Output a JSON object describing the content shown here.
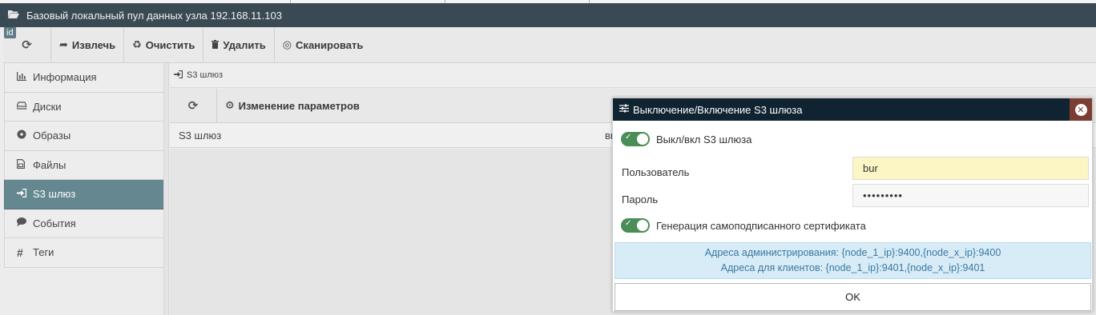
{
  "window": {
    "title": "Базовый локальный пул данных узла 192.168.11.103",
    "id_tag": "id"
  },
  "toolbar": {
    "extract_label": "Извлечь",
    "clear_label": "Очистить",
    "delete_label": "Удалить",
    "scan_label": "Сканировать"
  },
  "sidebar": {
    "items": [
      {
        "label": "Информация",
        "icon": "bar-chart-icon"
      },
      {
        "label": "Диски",
        "icon": "hdd-icon"
      },
      {
        "label": "Образы",
        "icon": "disc-icon"
      },
      {
        "label": "Файлы",
        "icon": "file-icon"
      },
      {
        "label": "S3 шлюз",
        "icon": "sign-in-icon",
        "active": true
      },
      {
        "label": "События",
        "icon": "comment-icon"
      },
      {
        "label": "Теги",
        "icon": "hashtag-icon"
      }
    ]
  },
  "breadcrumb": {
    "label": "S3 шлюз"
  },
  "subtoolbar": {
    "change_params_label": "Изменение параметров"
  },
  "table": {
    "columns": [
      "S3 шлюз",
      "вы"
    ]
  },
  "dialog": {
    "title": "Выключение/Включение S3 шлюза",
    "toggle_gateway_label": "Выкл/вкл S3 шлюза",
    "toggle_gateway_on": true,
    "user_label": "Пользователь",
    "user_value": "bur",
    "password_label": "Пароль",
    "password_value": "•••••••••",
    "toggle_cert_label": "Генерация самоподписанного сертификата",
    "toggle_cert_on": true,
    "admin_addresses": "Адреса администрирования: {node_1_ip}:9400,{node_x_ip}:9400",
    "client_addresses": "Адреса для клиентов: {node_1_ip}:9401,{node_x_ip}:9401",
    "ok_label": "OK"
  },
  "colors": {
    "titlebar": "#394a54",
    "sidebar_active": "#648790",
    "dialog_header": "#0f2330",
    "close_button": "#7b3d34",
    "toggle_on": "#4a8d57",
    "info_bg": "#d8ecf7",
    "info_text": "#3a78a1"
  }
}
